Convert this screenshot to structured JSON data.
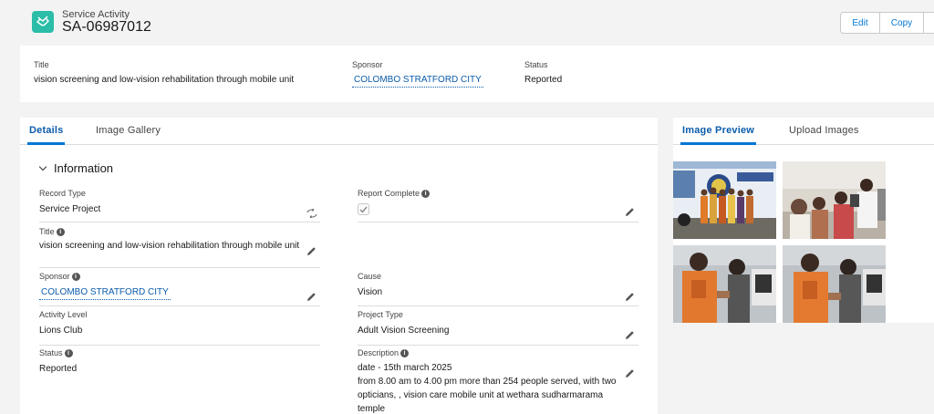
{
  "header": {
    "object_type": "Service Activity",
    "record_name": "SA-06987012",
    "buttons": {
      "edit": "Edit",
      "copy": "Copy"
    }
  },
  "highlights": {
    "title_label": "Title",
    "title_value": "vision screening and low-vision rehabilitation through mobile unit",
    "sponsor_label": "Sponsor",
    "sponsor_value": "COLOMBO STRATFORD CITY",
    "status_label": "Status",
    "status_value": "Reported"
  },
  "left_tabs": [
    "Details",
    "Image Gallery"
  ],
  "section": {
    "title": "Information"
  },
  "fields": {
    "record_type": {
      "label": "Record Type",
      "value": "Service Project"
    },
    "report_complete": {
      "label": "Report Complete",
      "checked": true
    },
    "title": {
      "label": "Title",
      "value": "vision screening and low-vision rehabilitation through mobile unit"
    },
    "sponsor": {
      "label": "Sponsor",
      "value": "COLOMBO STRATFORD CITY"
    },
    "cause": {
      "label": "Cause",
      "value": "Vision"
    },
    "activity_level": {
      "label": "Activity Level",
      "value": "Lions Club"
    },
    "project_type": {
      "label": "Project Type",
      "value": "Adult Vision Screening"
    },
    "status": {
      "label": "Status",
      "value": "Reported"
    },
    "description": {
      "label": "Description",
      "line1": "date - 15th march 2025",
      "line2": "from 8.00 am to 4.00 pm more than 254 people served, with two opticians, , vision care mobile unit at wethara sudharmarama temple"
    }
  },
  "right_tabs": [
    "Image Preview",
    "Upload Images"
  ],
  "colors": {
    "brand_teal": "#2bbda7",
    "link_blue": "#0b5cab",
    "active_tab": "#0176d3",
    "page_bg": "#f3f3f3"
  }
}
